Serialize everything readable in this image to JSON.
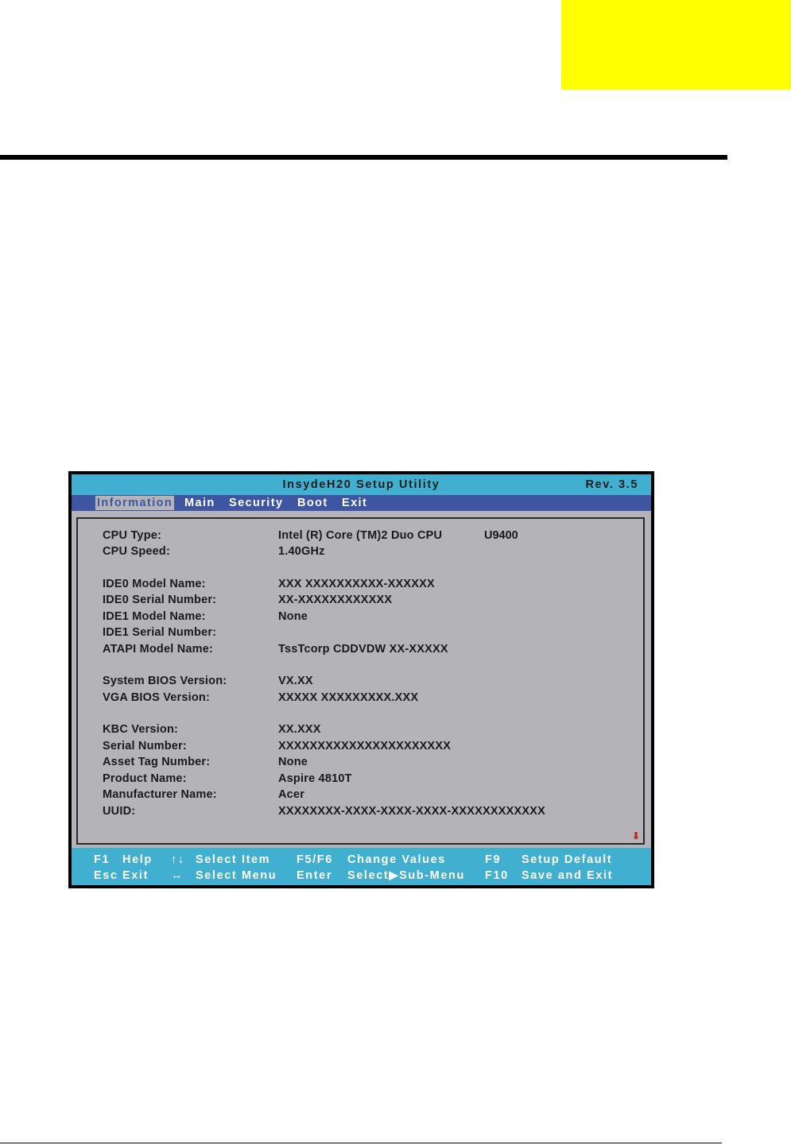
{
  "bios": {
    "title": "InsydeH20 Setup Utility",
    "revision": "Rev. 3.5",
    "menu": [
      "Information",
      "Main",
      "Security",
      "Boot",
      "Exit"
    ],
    "active_menu": "Information",
    "fields": [
      {
        "label": "CPU Type:",
        "value": "Intel (R) Core (TM)2 Duo CPU",
        "extra": "U9400"
      },
      {
        "label": "CPU Speed:",
        "value": "1.40GHz"
      },
      {
        "label": "IDE0 Model Name:",
        "value": "XXX XXXXXXXXXX-XXXXXX"
      },
      {
        "label": "IDE0 Serial Number:",
        "value": "XX-XXXXXXXXXXXX"
      },
      {
        "label": "IDE1 Model Name:",
        "value": "None"
      },
      {
        "label": "IDE1 Serial Number:",
        "value": ""
      },
      {
        "label": "ATAPI Model Name:",
        "value": "TssTcorp CDDVDW XX-XXXXX"
      },
      {
        "label": "System BIOS Version:",
        "value": "VX.XX"
      },
      {
        "label": "VGA BIOS Version:",
        "value": "XXXXX XXXXXXXXX.XXX"
      },
      {
        "label": "KBC Version:",
        "value": "XX.XXX"
      },
      {
        "label": "Serial Number:",
        "value": "XXXXXXXXXXXXXXXXXXXXXX"
      },
      {
        "label": "Asset Tag Number:",
        "value": "None"
      },
      {
        "label": "Product Name:",
        "value": "Aspire 4810T"
      },
      {
        "label": "Manufacturer Name:",
        "value": "Acer"
      },
      {
        "label": "UUID:",
        "value": "XXXXXXXX-XXXX-XXXX-XXXX-XXXXXXXXXXXX"
      }
    ],
    "footer": {
      "f1_key": "F1",
      "f1_label": "Help",
      "updown_icon": "↑↓",
      "updown_label": "Select Item",
      "f5f6_key": "F5/F6",
      "f5f6_label": "Change Values",
      "f9_key": "F9",
      "f9_label": "Setup Default",
      "esc_key": "Esc",
      "esc_label": "Exit",
      "leftright_icon": "↔",
      "leftright_label": "Select Menu",
      "enter_key": "Enter",
      "enter_label": "Select▶Sub-Menu",
      "f10_key": "F10",
      "f10_label": "Save and Exit"
    }
  },
  "colors": {
    "title_bar": "#41b0d0",
    "menu_bar": "#3e56a2",
    "content_bg": "#b4b3b8",
    "highlight": "#ffff00"
  }
}
